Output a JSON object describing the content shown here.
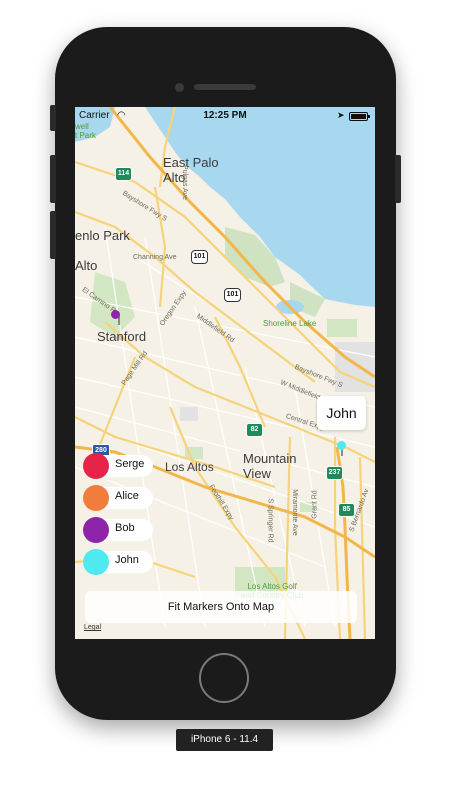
{
  "status_bar": {
    "carrier": "Carrier",
    "time": "12:25 PM"
  },
  "map": {
    "places": {
      "east_palo_alto": "East Palo\nAlto",
      "menlo_park": "enlo Park",
      "palo_alto": "Alto",
      "stanford": "Stanford",
      "los_altos": "Los Altos",
      "mountain_view": "Mountain\nView",
      "shoreline_lake": "Shoreline Lake",
      "los_altos_golf": "Los Altos Golf\nand Country Club",
      "top_park": "well\nt Park"
    },
    "roads": {
      "bayshore_1": "Bayshore Fwy S",
      "bayshore_2": "Bayshore Fwy S",
      "pulgas": "Pulgas Ave",
      "channing": "Channing Ave",
      "el_camino": "El Camino R",
      "oregon": "Oregon Expy",
      "middlefield": "Middlefield Rd",
      "page_mill": "Page Mill Rd",
      "w_middlefield": "W Middlefield",
      "central": "Central Expy",
      "foothill": "Foothill Expy",
      "springer": "S Springer Rd",
      "miramonte": "Miramonte Ave",
      "grant": "Grant Rd",
      "bernardo": "S Bernardo Av"
    },
    "shields": {
      "r114": "114",
      "r101a": "101",
      "r101b": "101",
      "r82": "82",
      "i280": "280",
      "r237": "237",
      "r85": "85"
    },
    "callout": "John"
  },
  "legend": [
    {
      "name": "Serge",
      "color": "#e8234a"
    },
    {
      "name": "Alice",
      "color": "#f07d3c"
    },
    {
      "name": "Bob",
      "color": "#8e24aa"
    },
    {
      "name": "John",
      "color": "#4eeaf0"
    }
  ],
  "fit_button_label": "Fit Markers Onto Map",
  "legal_label": "Legal",
  "device_label": "iPhone 6 - 11.4"
}
